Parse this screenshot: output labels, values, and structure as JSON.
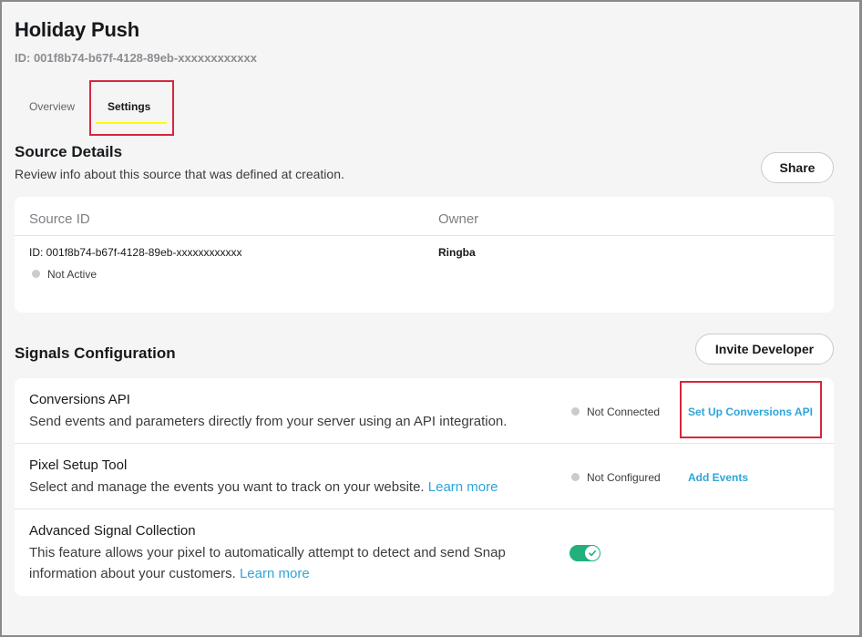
{
  "header": {
    "title": "Holiday Push",
    "id_line": "ID: 001f8b74-b67f-4128-89eb-xxxxxxxxxxxx"
  },
  "tabs": [
    {
      "label": "Overview",
      "active": false
    },
    {
      "label": "Settings",
      "active": true
    }
  ],
  "source_details": {
    "title": "Source Details",
    "subtitle": "Review info about this source that was defined at creation.",
    "share_label": "Share",
    "columns": [
      "Source ID",
      "Owner"
    ],
    "source_id": "ID: 001f8b74-b67f-4128-89eb-xxxxxxxxxxxx",
    "status": "Not Active",
    "owner": "Ringba"
  },
  "signals": {
    "title": "Signals Configuration",
    "invite_label": "Invite Developer",
    "rows": [
      {
        "title": "Conversions API",
        "description": "Send events and parameters directly from your server using an API integration.",
        "status": "Not Connected",
        "action": "Set Up Conversions API"
      },
      {
        "title": "Pixel Setup Tool",
        "description": "Select and manage the events you want to track on your website.",
        "learn_more": "Learn more",
        "status": "Not Configured",
        "action": "Add Events"
      },
      {
        "title": "Advanced Signal Collection",
        "description_line1": "This feature allows your pixel to automatically attempt to detect and send Snap",
        "description_line2": "information about your customers.",
        "learn_more": "Learn more",
        "toggle_on": true
      }
    ]
  },
  "colors": {
    "accent_link": "#2fa5d8",
    "toggle_on": "#22b07d",
    "tab_underline": "#fffc00",
    "annotation": "#d7263d"
  }
}
